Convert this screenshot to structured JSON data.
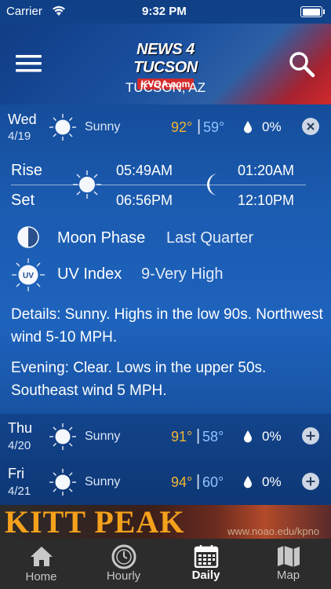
{
  "status_bar": {
    "carrier": "Carrier",
    "time": "9:32 PM"
  },
  "header": {
    "logo_top": "NEWS 4 TUCSON",
    "logo_sub": "KVOA.com",
    "location": "TUCSON, AZ"
  },
  "today": {
    "day": "Wed",
    "date": "4/19",
    "condition": "Sunny",
    "high": "92°",
    "low": "59°",
    "precip": "0%",
    "rise_label": "Rise",
    "set_label": "Set",
    "sunrise": "05:49AM",
    "sunset": "06:56PM",
    "moonrise": "01:20AM",
    "moonset": "12:10PM",
    "moon_phase_label": "Moon Phase",
    "moon_phase": "Last Quarter",
    "uv_label": "UV Index",
    "uv_value": "9-Very High",
    "details": "Details: Sunny. Highs in the low 90s. Northwest wind 5-10 MPH.",
    "evening": "Evening: Clear. Lows in the upper 50s. Southeast wind 5 MPH."
  },
  "forecast": [
    {
      "day": "Thu",
      "date": "4/20",
      "condition": "Sunny",
      "high": "91°",
      "low": "58°",
      "precip": "0%"
    },
    {
      "day": "Fri",
      "date": "4/21",
      "condition": "Sunny",
      "high": "94°",
      "low": "60°",
      "precip": "0%"
    }
  ],
  "ad": {
    "title": "KITT PEAK",
    "url": "www.noao.edu/kpno"
  },
  "tabs": [
    {
      "label": "Home",
      "icon": "home-icon"
    },
    {
      "label": "Hourly",
      "icon": "clock-icon"
    },
    {
      "label": "Daily",
      "icon": "calendar-icon"
    },
    {
      "label": "Map",
      "icon": "map-icon"
    }
  ]
}
